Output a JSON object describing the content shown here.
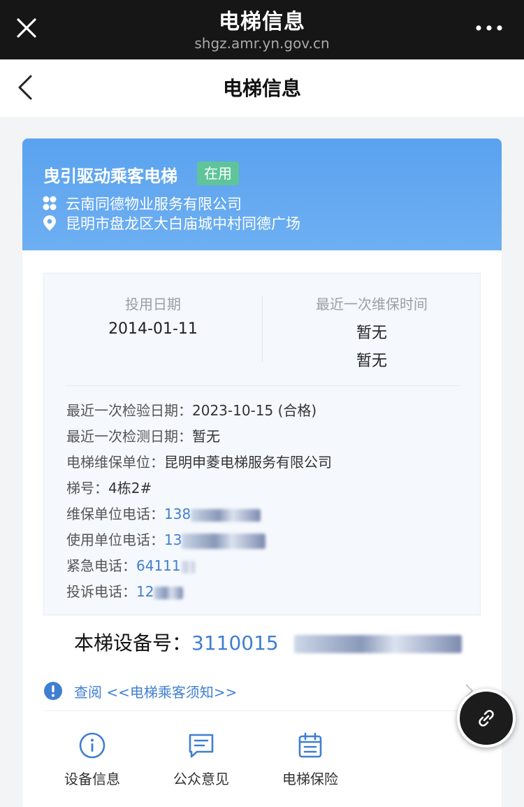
{
  "browser": {
    "title": "电梯信息",
    "domain": "shgz.amr.yn.gov.cn"
  },
  "nav": {
    "title": "电梯信息"
  },
  "elevator": {
    "type": "曳引驱动乘客电梯",
    "status": "在用",
    "company": "云南同德物业服务有限公司",
    "address": "昆明市盘龙区大白庙城中村同德广场"
  },
  "summary": {
    "commission_label": "投用日期",
    "commission_date": "2014-01-11",
    "maintenance_label": "最近一次维保时间",
    "maintenance_value_1": "暂无",
    "maintenance_value_2": "暂无"
  },
  "details": {
    "inspection_label": "最近一次检验日期：",
    "inspection_value": "2023-10-15 (合格)",
    "testing_label": "最近一次检测日期：",
    "testing_value": "暂无",
    "maint_unit_label": "电梯维保单位：",
    "maint_unit_value": "昆明申菱电梯服务有限公司",
    "number_label": "梯号：",
    "number_value": "4栋2#",
    "maint_phone_label": "维保单位电话：",
    "maint_phone_value": "138",
    "user_phone_label": "使用单位电话：",
    "user_phone_value": "13",
    "emergency_label": "紧急电话：",
    "emergency_value": "64111",
    "complaint_label": "投诉电话：",
    "complaint_value": "12"
  },
  "device": {
    "label": "本梯设备号：",
    "number": "3110015"
  },
  "notice": {
    "link": "查阅 <<电梯乘客须知>>"
  },
  "tabs": [
    {
      "label": "设备信息",
      "icon": "info-circle-icon"
    },
    {
      "label": "公众意见",
      "icon": "message-icon"
    },
    {
      "label": "电梯保险",
      "icon": "calendar-icon"
    }
  ],
  "colors": {
    "header_blue": "#5aa2ef",
    "status_green": "#5fc49a",
    "link_blue": "#3f7fd1"
  }
}
